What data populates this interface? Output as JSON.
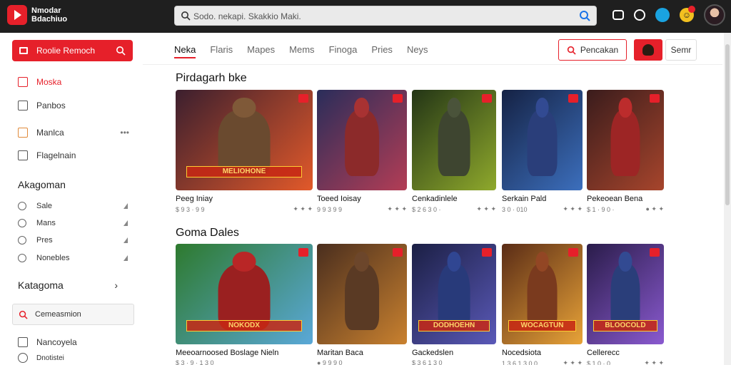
{
  "app": {
    "logo_line1": "Nmodar",
    "logo_line2": "Bdachiuo"
  },
  "search": {
    "placeholder": "Sodo. nekapi. Skakkio Maki."
  },
  "top_icons": [
    "controller-icon",
    "trophy-icon",
    "globe-icon",
    "notification-icon"
  ],
  "sidebar": {
    "primary_button": "Roolie Remoch",
    "items": [
      {
        "label": "Moska",
        "icon": "home-icon",
        "active": true
      },
      {
        "label": "Panbos",
        "icon": "document-icon"
      },
      {
        "label": "Manlca",
        "icon": "bookmark-icon",
        "more": "•••"
      },
      {
        "label": "Flagelnain",
        "icon": "bell-icon"
      }
    ],
    "section1_title": "Akagoman",
    "sub_items": [
      {
        "label": "Sale"
      },
      {
        "label": "Mans"
      },
      {
        "label": "Pres"
      },
      {
        "label": "Nonebles"
      }
    ],
    "section2_title": "Katagoma",
    "section2_chevron": "›",
    "search_label": "Cemeasmion",
    "bottom_items": [
      {
        "label": "Nancoyela"
      },
      {
        "label": "Dnotistei"
      }
    ]
  },
  "tabs": [
    {
      "label": "Neka",
      "active": true
    },
    {
      "label": "Flaris"
    },
    {
      "label": "Mapes"
    },
    {
      "label": "Mems"
    },
    {
      "label": "Finoga"
    },
    {
      "label": "Pries"
    },
    {
      "label": "Neys"
    }
  ],
  "actions": {
    "search_button": "Pencakan",
    "small_button": "Semr"
  },
  "sections": [
    {
      "title": "Pirdagarh bke",
      "cards": [
        {
          "title": "Peeg Iniay",
          "meta_left": "$ 9 3  ·  9 9",
          "meta_right": "✦ ✦ ✦",
          "banner": "MELIOHONE",
          "bg1": "#3b1f2e",
          "bg2": "#e2592a",
          "hero": "#6a4a2f"
        },
        {
          "title": "Toeed Ioisay",
          "meta_left": "9 9 3 9 9",
          "meta_right": "✦ ✦ ✦",
          "banner": "",
          "bg1": "#2a2d5a",
          "bg2": "#b33d55",
          "hero": "#8c2a2a"
        },
        {
          "title": "Cenkadinlele",
          "meta_left": "$ 2 6 3 0 ·",
          "meta_right": "✦ ✦ ✦",
          "banner": "",
          "bg1": "#233516",
          "bg2": "#8fa92c",
          "hero": "#3e4530"
        },
        {
          "title": "Serkain Pald",
          "meta_left": "3 0 · 010",
          "meta_right": "✦ ✦ ✦",
          "banner": "",
          "bg1": "#152244",
          "bg2": "#3c6fbd",
          "hero": "#2a3e7a"
        },
        {
          "title": "Pekeoean Bena",
          "meta_left": "$ 1 · 9 0 ·",
          "meta_right": "● ✦ ✦",
          "banner": "",
          "bg1": "#3a1c1c",
          "bg2": "#a7452c",
          "hero": "#9d2525"
        }
      ]
    },
    {
      "title": "Goma Dales",
      "cards": [
        {
          "title": "Meeoarnoosed Boslage Nieln",
          "meta_left": "$ 3 · 9 · 1 3 0",
          "meta_right": "",
          "banner": "NOKODX",
          "bg1": "#2e7a2e",
          "bg2": "#5aa8d8",
          "hero": "#9a2020"
        },
        {
          "title": "Maritan Baca",
          "meta_left": "● 9 9 9 0",
          "meta_right": "",
          "banner": "",
          "bg1": "#4a2e1e",
          "bg2": "#c9812f",
          "hero": "#5a3a24"
        },
        {
          "title": "Gackedslen",
          "meta_left": "$ 3 6 1 3 0",
          "meta_right": "",
          "banner": "DODHOEHN",
          "bg1": "#1b1f44",
          "bg2": "#5a59b8",
          "hero": "#283a7a"
        },
        {
          "title": "Nocedsiota",
          "meta_left": "1 3 6 1 3 0 0",
          "meta_right": "✦ ✦ ✦",
          "banner": "WOCAGTUN",
          "bg1": "#5a2c16",
          "bg2": "#e8a338",
          "hero": "#7a3a1e"
        },
        {
          "title": "Cellerecc",
          "meta_left": "$ 1 0 · 0",
          "meta_right": "✦ ✦ ✦",
          "banner": "BLOOCOLD",
          "bg1": "#2a1c4a",
          "bg2": "#8a5ad0",
          "hero": "#2a3e7a"
        }
      ]
    }
  ],
  "colors": {
    "accent": "#e6202a",
    "topbar": "#1f1f1f"
  }
}
